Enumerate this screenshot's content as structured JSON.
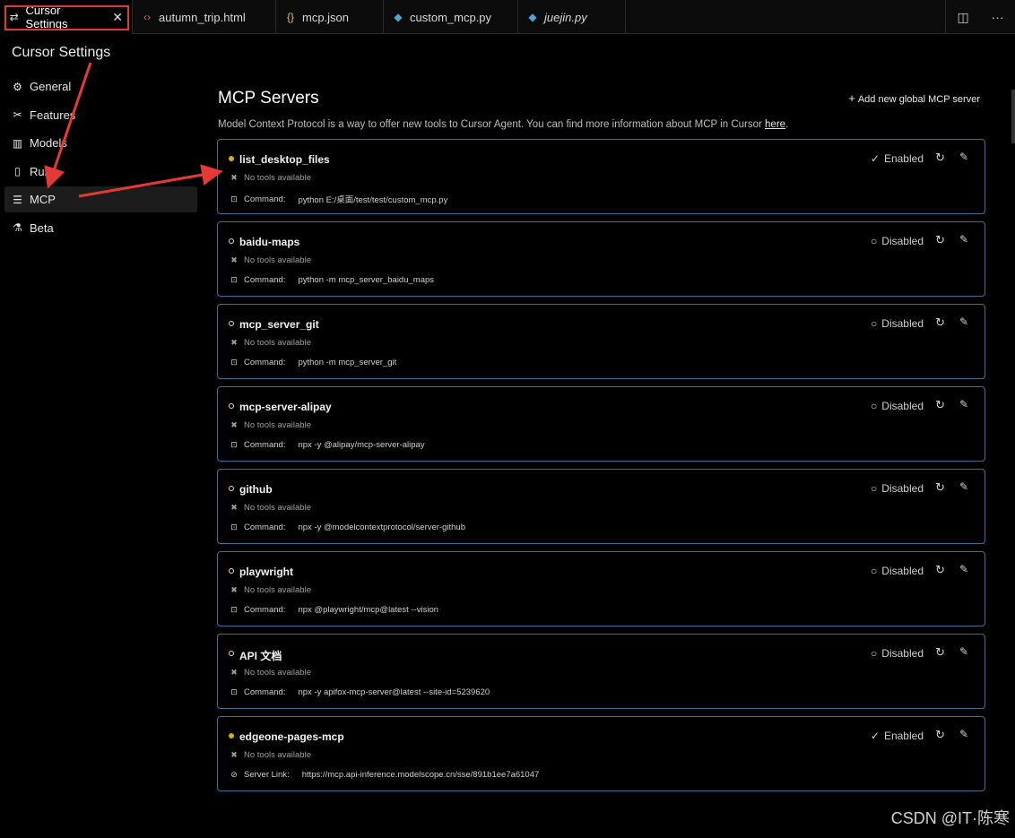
{
  "tabs": [
    {
      "label": "Cursor Settings",
      "icon": "settings-sliders-icon",
      "icon_glyph": "⇄",
      "icon_color": "#dddddd",
      "active": true,
      "italic": false
    },
    {
      "label": "autumn_trip.html",
      "icon": "html-code-icon",
      "icon_glyph": "‹›",
      "icon_color": "#e8703a",
      "active": false,
      "italic": false
    },
    {
      "label": "mcp.json",
      "icon": "json-braces-icon",
      "icon_glyph": "{}",
      "icon_color": "#e5c07b",
      "active": false,
      "italic": false
    },
    {
      "label": "custom_mcp.py",
      "icon": "python-icon",
      "icon_glyph": "◆",
      "icon_color": "#4fa3d1",
      "active": false,
      "italic": false
    },
    {
      "label": "juejin.py",
      "icon": "python-icon",
      "icon_glyph": "◆",
      "icon_color": "#4fa3d1",
      "active": false,
      "italic": true
    }
  ],
  "tab_close_glyph": "✕",
  "tab_actions": {
    "split_glyph": "◫",
    "more_glyph": "···"
  },
  "settings_title": "Cursor Settings",
  "sidebar": {
    "items": [
      {
        "label": "General",
        "icon": "gear-icon",
        "glyph": "⚙",
        "active": false
      },
      {
        "label": "Features",
        "icon": "tools-icon",
        "glyph": "✂",
        "active": false
      },
      {
        "label": "Models",
        "icon": "bar-chart-icon",
        "glyph": "▥",
        "active": false
      },
      {
        "label": "Rules",
        "icon": "book-icon",
        "glyph": "▯",
        "active": false
      },
      {
        "label": "MCP",
        "icon": "server-icon",
        "glyph": "☰",
        "active": true
      },
      {
        "label": "Beta",
        "icon": "flask-icon",
        "glyph": "⚗",
        "active": false
      }
    ]
  },
  "main": {
    "title": "MCP Servers",
    "add_button": "Add new global MCP server",
    "add_glyph": "+",
    "description": "Model Context Protocol is a way to offer new tools to Cursor Agent. You can find more information about MCP in Cursor ",
    "description_link": "here",
    "description_end": "."
  },
  "servers": [
    {
      "name": "list_desktop_files",
      "enabled": true,
      "status": "Enabled",
      "tools": "No tools available",
      "cmd_label": "Command:",
      "cmd": "python E:/桌面/test/test/custom_mcp.py",
      "cmd_icon": "terminal-icon"
    },
    {
      "name": "baidu-maps",
      "enabled": false,
      "status": "Disabled",
      "tools": "No tools available",
      "cmd_label": "Command:",
      "cmd": "python -m mcp_server_baidu_maps",
      "cmd_icon": "terminal-icon"
    },
    {
      "name": "mcp_server_git",
      "enabled": false,
      "status": "Disabled",
      "tools": "No tools available",
      "cmd_label": "Command:",
      "cmd": "python -m mcp_server_git",
      "cmd_icon": "terminal-icon"
    },
    {
      "name": "mcp-server-alipay",
      "enabled": false,
      "status": "Disabled",
      "tools": "No tools available",
      "cmd_label": "Command:",
      "cmd": "npx -y @alipay/mcp-server-alipay",
      "cmd_icon": "terminal-icon"
    },
    {
      "name": "github",
      "enabled": false,
      "status": "Disabled",
      "tools": "No tools available",
      "cmd_label": "Command:",
      "cmd": "npx -y @modelcontextprotocol/server-github",
      "cmd_icon": "terminal-icon"
    },
    {
      "name": "playwright",
      "enabled": false,
      "status": "Disabled",
      "tools": "No tools available",
      "cmd_label": "Command:",
      "cmd": "npx @playwright/mcp@latest --vision",
      "cmd_icon": "terminal-icon"
    },
    {
      "name": "API 文档",
      "enabled": false,
      "status": "Disabled",
      "tools": "No tools available",
      "cmd_label": "Command:",
      "cmd": "npx -y apifox-mcp-server@latest --site-id=5239620",
      "cmd_icon": "terminal-icon"
    },
    {
      "name": "edgeone-pages-mcp",
      "enabled": true,
      "status": "Enabled",
      "tools": "No tools available",
      "cmd_label": "Server Link:",
      "cmd": "https://mcp.api-inference.modelscope.cn/sse/891b1ee7a61047",
      "cmd_icon": "link-icon"
    }
  ],
  "glyphs": {
    "check": "✓",
    "circle": "○",
    "refresh": "↻",
    "edit": "✎",
    "tools": "✖",
    "terminal": "⊡",
    "link": "⊘"
  },
  "watermark": "CSDN @IT·陈寒",
  "colors": {
    "accent_border": "#3e6f9a",
    "enabled_dot": "#d4b106",
    "annotation_red": "#e53935"
  }
}
